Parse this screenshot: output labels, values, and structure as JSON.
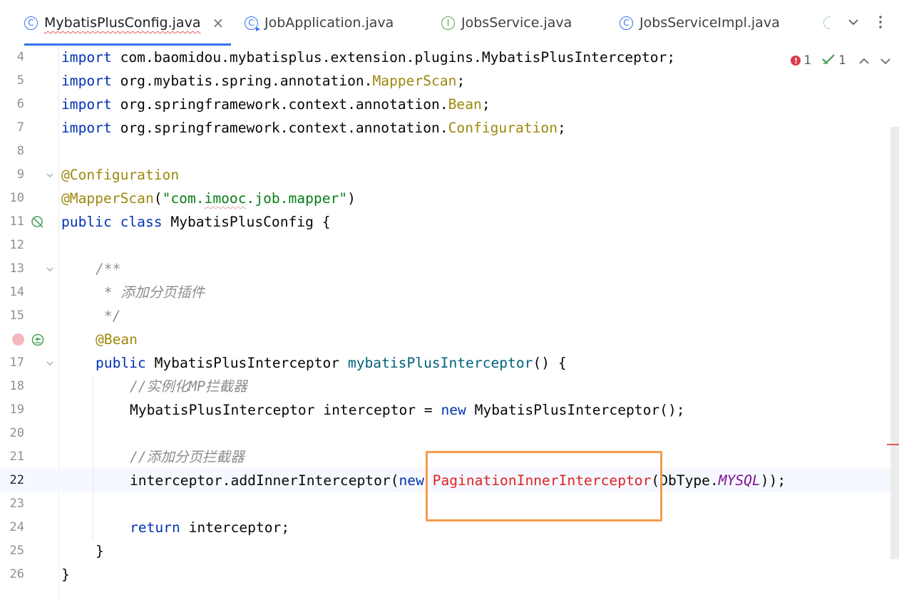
{
  "tabs": [
    {
      "label": "MybatisPlusConfig.java",
      "icon": "class-icon",
      "active": true
    },
    {
      "label": "JobApplication.java",
      "icon": "run-class-icon",
      "active": false
    },
    {
      "label": "JobsService.java",
      "icon": "interface-icon",
      "active": false
    },
    {
      "label": "JobsServiceImpl.java",
      "icon": "class-icon",
      "active": false
    }
  ],
  "inspections": {
    "errors": "1",
    "passed": "1"
  },
  "lines": [
    {
      "num": "4"
    },
    {
      "num": "5"
    },
    {
      "num": "6"
    },
    {
      "num": "7"
    },
    {
      "num": "8"
    },
    {
      "num": "9"
    },
    {
      "num": "10"
    },
    {
      "num": "11"
    },
    {
      "num": "12"
    },
    {
      "num": "13"
    },
    {
      "num": "14"
    },
    {
      "num": "15"
    },
    {
      "num": ""
    },
    {
      "num": "17"
    },
    {
      "num": "18"
    },
    {
      "num": "19"
    },
    {
      "num": "20"
    },
    {
      "num": "21"
    },
    {
      "num": "22"
    },
    {
      "num": "23"
    },
    {
      "num": "24"
    },
    {
      "num": "25"
    },
    {
      "num": "26"
    }
  ],
  "code": {
    "l4": {
      "kw": "import",
      "rest": " com.baomidou.mybatisplus.extension.plugins.MybatisPlusInterceptor;"
    },
    "l5": {
      "kw": "import",
      "pkg": " org.mybatis.spring.annotation.",
      "cls": "MapperScan",
      "end": ";"
    },
    "l6": {
      "kw": "import",
      "pkg": " org.springframework.context.annotation.",
      "cls": "Bean",
      "end": ";"
    },
    "l7": {
      "kw": "import",
      "pkg": " org.springframework.context.annotation.",
      "cls": "Configuration",
      "end": ";"
    },
    "l9": {
      "anno": "@Configuration"
    },
    "l10": {
      "anno": "@MapperScan",
      "open": "(",
      "str_a": "\"com.",
      "str_b": "imooc",
      "str_c": ".job.mapper\"",
      "close": ")"
    },
    "l11": {
      "kw1": "public",
      "kw2": "class",
      "rest": " MybatisPlusConfig {"
    },
    "l13": {
      "cmt": "/**"
    },
    "l14": {
      "cmt": " * 添加分页插件"
    },
    "l15": {
      "cmt": " */"
    },
    "l16": {
      "anno": "@Bean"
    },
    "l17": {
      "kw": "public",
      "type": " MybatisPlusInterceptor ",
      "meth": "mybatisPlusInterceptor",
      "rest": "() {"
    },
    "l18": {
      "cmt": "//实例化MP拦截器"
    },
    "l19": {
      "a": "MybatisPlusInterceptor interceptor = ",
      "kw": "new",
      "b": " MybatisPlusInterceptor();"
    },
    "l21": {
      "cmt": "//添加分页拦截器"
    },
    "l22": {
      "a": "interceptor.addInnerInterceptor(",
      "kw": "new",
      "err": "PaginationInnerInterceptor",
      "b": "(DbType.",
      "cst": "MYSQL",
      "c": "));"
    },
    "l24": {
      "kw": "return",
      "rest": " interceptor;"
    },
    "l25": {
      "text": "}"
    },
    "l26": {
      "text": "}"
    }
  }
}
